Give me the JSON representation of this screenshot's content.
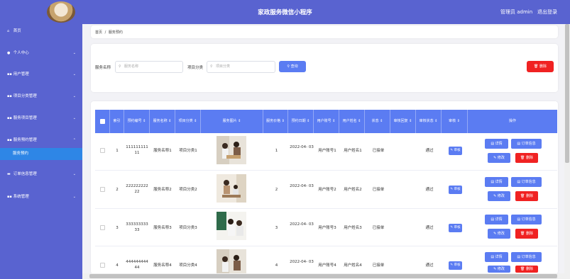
{
  "header": {
    "title": "家政服务微信小程序",
    "admin_label": "管理员 admin",
    "logout_label": "退出登录"
  },
  "sidebar": {
    "items": [
      {
        "label": "首页",
        "icon": "home-icon"
      },
      {
        "label": "个人中心",
        "icon": "user-icon"
      },
      {
        "label": "用户管理",
        "icon": "grid-icon"
      },
      {
        "label": "项目分类管理",
        "icon": "grid-icon"
      },
      {
        "label": "服务项目管理",
        "icon": "grid-icon"
      },
      {
        "label": "服务预约管理",
        "icon": "grid-icon"
      },
      {
        "label": "订单信息管理",
        "icon": "folder-icon"
      },
      {
        "label": "系统管理",
        "icon": "grid-icon"
      }
    ],
    "active_sub": "服务预约"
  },
  "breadcrumb": {
    "home": "首页",
    "sep": "/",
    "current": "服务预约"
  },
  "search": {
    "name_label": "服务名称",
    "name_placeholder": "服务名称",
    "cat_label": "项目分类",
    "cat_placeholder": "项目分类",
    "query_label": "查询",
    "delete_label": "删除"
  },
  "table": {
    "headers": [
      "索引",
      "预约编号 ⇕",
      "服务名称 ⇕",
      "项目分类 ⇕",
      "服务图片 ⇕",
      "服务价格 ⇕",
      "预约日期 ⇕",
      "用户账号 ⇕",
      "用户姓名 ⇕",
      "状态 ⇕",
      "审核回复 ⇕",
      "审核状态 ⇕",
      "审核 ⇕",
      "操作"
    ],
    "rows": [
      {
        "index": "1",
        "code": "111111111 11",
        "name": "服务名称1",
        "cat": "项目分类1",
        "price": "1",
        "date": "2022-04- 03",
        "account": "用户账号1",
        "uname": "用户姓名1",
        "status": "已接单",
        "reply": "",
        "audit_status": "通过"
      },
      {
        "index": "2",
        "code": "222222222 22",
        "name": "服务名称2",
        "cat": "项目分类2",
        "price": "2",
        "date": "2022-04- 03",
        "account": "用户账号2",
        "uname": "用户姓名2",
        "status": "已接单",
        "reply": "",
        "audit_status": "通过"
      },
      {
        "index": "3",
        "code": "333333333 33",
        "name": "服务名称3",
        "cat": "项目分类3",
        "price": "3",
        "date": "2022-04- 03",
        "account": "用户账号3",
        "uname": "用户姓名3",
        "status": "已接单",
        "reply": "",
        "audit_status": "通过"
      },
      {
        "index": "4",
        "code": "444444444 44",
        "name": "服务名称4",
        "cat": "项目分类4",
        "price": "4",
        "date": "2022-04- 03",
        "account": "用户账号4",
        "uname": "用户姓名4",
        "status": "已接单",
        "reply": "",
        "audit_status": "通过"
      }
    ],
    "actions": {
      "detail": "详情",
      "order": "订单信息",
      "edit": "修改",
      "delete": "删除",
      "audit": "审核"
    }
  }
}
